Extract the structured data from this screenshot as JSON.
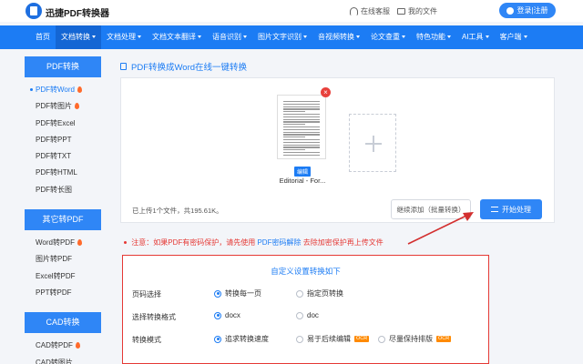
{
  "header": {
    "brand": "迅捷PDF转换器",
    "service_link": "在线客服",
    "my_files_link": "我的文件",
    "login_label": "登录|注册"
  },
  "nav": {
    "items": [
      {
        "label": "首页",
        "caret": false,
        "active": false
      },
      {
        "label": "文档转换",
        "caret": true,
        "active": true
      },
      {
        "label": "文档处理",
        "caret": true,
        "active": false
      },
      {
        "label": "文档文本翻译",
        "caret": true,
        "active": false
      },
      {
        "label": "语音识别",
        "caret": true,
        "active": false
      },
      {
        "label": "图片文字识别",
        "caret": true,
        "active": false
      },
      {
        "label": "音视频转换",
        "caret": true,
        "active": false
      },
      {
        "label": "论文查重",
        "caret": true,
        "active": false
      },
      {
        "label": "特色功能",
        "caret": true,
        "active": false
      },
      {
        "label": "AI工具",
        "caret": true,
        "active": false
      },
      {
        "label": "客户端",
        "caret": true,
        "active": false
      }
    ]
  },
  "sidebar": {
    "sections": [
      {
        "title": "PDF转换",
        "items": [
          {
            "label": "PDF转Word",
            "hot": true,
            "active": true
          },
          {
            "label": "PDF转图片",
            "hot": true,
            "active": false
          },
          {
            "label": "PDF转Excel",
            "hot": false,
            "active": false
          },
          {
            "label": "PDF转PPT",
            "hot": false,
            "active": false
          },
          {
            "label": "PDF转TXT",
            "hot": false,
            "active": false
          },
          {
            "label": "PDF转HTML",
            "hot": false,
            "active": false
          },
          {
            "label": "PDF转长图",
            "hot": false,
            "active": false
          }
        ]
      },
      {
        "title": "其它转PDF",
        "items": [
          {
            "label": "Word转PDF",
            "hot": true,
            "active": false
          },
          {
            "label": "图片转PDF",
            "hot": false,
            "active": false
          },
          {
            "label": "Excel转PDF",
            "hot": false,
            "active": false
          },
          {
            "label": "PPT转PDF",
            "hot": false,
            "active": false
          }
        ]
      },
      {
        "title": "CAD转换",
        "items": [
          {
            "label": "CAD转PDF",
            "hot": true,
            "active": false
          },
          {
            "label": "CAD转图片",
            "hot": false,
            "active": false
          }
        ]
      }
    ]
  },
  "main": {
    "title": "PDF转换成Word在线一键转换",
    "file": {
      "name": "Editorial - For...",
      "edit_tag": "编辑",
      "close": "×"
    },
    "upload_status": "已上传1个文件，共195.61K。",
    "continue_button": "继续添加（批量转换）",
    "start_button": "开始处理",
    "notice": {
      "prefix": "注意：如果PDF有密码保护，请先使用",
      "link": "PDF密码解除",
      "suffix": "去除加密保护再上传文件"
    },
    "settings": {
      "title": "自定义设置转换如下",
      "rows": [
        {
          "label": "页码选择",
          "options": [
            {
              "label": "转换每一页",
              "selected": true,
              "ocr": false
            },
            {
              "label": "指定页转换",
              "selected": false,
              "ocr": false
            }
          ]
        },
        {
          "label": "选择转换格式",
          "options": [
            {
              "label": "docx",
              "selected": true,
              "ocr": false
            },
            {
              "label": "doc",
              "selected": false,
              "ocr": false
            }
          ]
        },
        {
          "label": "转换模式",
          "options": [
            {
              "label": "追求转换速度",
              "selected": true,
              "ocr": false
            },
            {
              "label": "易于后续编辑",
              "selected": false,
              "ocr": true
            },
            {
              "label": "尽量保持排版",
              "selected": false,
              "ocr": true
            }
          ]
        }
      ],
      "ocr_badge": "OCR"
    }
  },
  "colors": {
    "primary": "#1c7cf4",
    "highlight_border": "#e53935",
    "annotation_arrow": "#d32f2f"
  }
}
